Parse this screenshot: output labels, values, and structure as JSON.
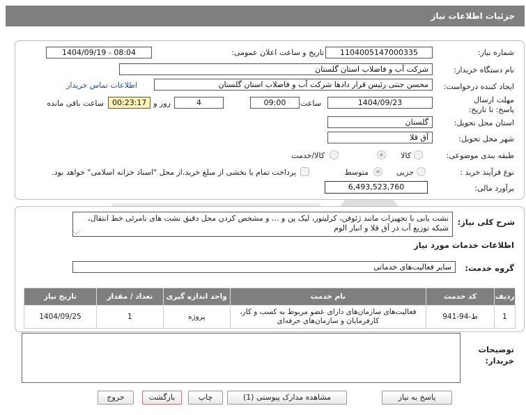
{
  "page": {
    "title": "جزئیات اطلاعات نیاز"
  },
  "details": {
    "need_number_label": "شماره نیاز:",
    "need_number": "1104005147000335",
    "announce_label": "تاریخ و ساعت اعلان عمومی:",
    "announce_value": "1404/09/19 - 08:04",
    "buyer_org_label": "نام دستگاه خریدار:",
    "buyer_org": "شرکت آب و فاضلاب استان گلستان",
    "creator_label": "ایجاد کننده درخواست:",
    "creator": "محسن جنتی رئیس قرار دادها شرکت آب و فاضلاب استان گلستان",
    "buyer_contact_link": "اطلاعات تماس خریدار",
    "deadline_label": "مهلت ارسال پاسخ: تا تاریخ:",
    "deadline_date": "1404/09/23",
    "time_label": "ساعت",
    "deadline_time": "09:00",
    "days_value": "4",
    "days_label": "روز و",
    "remaining_time": "00:23:17",
    "remaining_label": "ساعت باقی مانده",
    "province_label": "استان محل تحویل:",
    "province": "گلستان",
    "city_label": "شهر محل تحویل:",
    "city": "آق قلا",
    "category_label": "طبقه بندی موضوعی:",
    "category_options": [
      "کالا",
      "کالا/خدمت"
    ],
    "process_label": "نوع فرآیند خرید :",
    "process_options": [
      "جزیی",
      "متوسط"
    ],
    "payment_note": "پرداخت تمام یا بخشی از مبلغ خرید،از محل \"اسناد خزانه اسلامی\" خواهد بود.",
    "budget_label": "برآورد مالی:",
    "budget": "6,493,523,760"
  },
  "description": {
    "label": "شرح کلی نیاز:",
    "text": "نشت یابی با تجهیزات مانند ژئوفن، کرلیتور، لیک پن و ... و مشخص کردن محل دقیق نشت های نامرئی  خط انتقال، شبکه توزیع آب در  آق قلا و انبار الوم"
  },
  "services": {
    "section_title": "اطلاعات خدمات مورد نیاز",
    "group_label": "گروه خدمت:",
    "group_value": "سایر فعالیت‌های خدماتی",
    "columns": [
      "ردیف",
      "کد خدمت",
      "نام خدمت",
      "واحد اندازه گیری",
      "تعداد / مقدار",
      "تاریخ نیاز"
    ],
    "rows": [
      {
        "index": "1",
        "code": "ط-94-941",
        "name": "فعالیت‌های سازمان‌های دارای عضو مربوط به کسب و کار، کارفرمایان و سازمان‌های حرفه‌ای",
        "unit": "پروژه",
        "quantity": "1",
        "date": "1404/09/25"
      }
    ]
  },
  "buyer_notes": {
    "label": "توضیحات خریدار:",
    "value": ""
  },
  "buttons": {
    "reply": "پاسخ به نیاز",
    "attachments": "مشاهده مدارک پیوستی (1)",
    "print": "چاپ",
    "back": "بازگشت",
    "exit": "خروج"
  },
  "colors": {
    "header": "#7f7f7f",
    "highlight": "#fff3b5",
    "link": "#1a4fb5",
    "back_border": "#e07070"
  }
}
